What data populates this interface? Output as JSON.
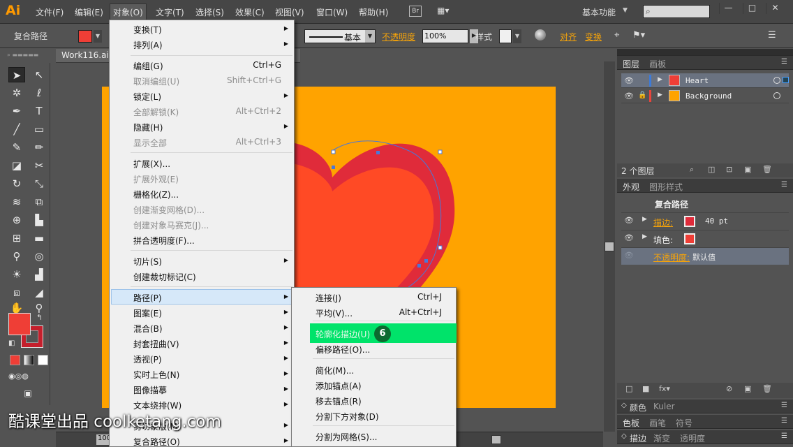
{
  "app": {
    "logo": "Ai"
  },
  "menubar": {
    "items": [
      "文件(F)",
      "编辑(E)",
      "对象(O)",
      "文字(T)",
      "选择(S)",
      "效果(C)",
      "视图(V)",
      "窗口(W)",
      "帮助(H)"
    ],
    "bridge": "Br",
    "workspace": "基本功能",
    "window_buttons": [
      "—",
      "□",
      "✕"
    ]
  },
  "control": {
    "selection_label": "复合路径",
    "fill_color": "#ef3e36",
    "stroke_style": "基本",
    "opacity_label": "不透明度",
    "opacity_value": "100%",
    "style_label": "样式",
    "align": "对齐",
    "transform": "变换"
  },
  "document": {
    "tab_label": "Work116.ai",
    "zoom": "100"
  },
  "object_menu": {
    "items": [
      {
        "label": "变换(T)",
        "shortcut": "",
        "submenu": true,
        "disabled": false
      },
      {
        "label": "排列(A)",
        "shortcut": "",
        "submenu": true,
        "disabled": false
      },
      {
        "label": "编组(G)",
        "shortcut": "Ctrl+G",
        "submenu": false,
        "disabled": false
      },
      {
        "label": "取消编组(U)",
        "shortcut": "Shift+Ctrl+G",
        "submenu": false,
        "disabled": true
      },
      {
        "label": "锁定(L)",
        "shortcut": "",
        "submenu": true,
        "disabled": false
      },
      {
        "label": "全部解锁(K)",
        "shortcut": "Alt+Ctrl+2",
        "submenu": false,
        "disabled": true
      },
      {
        "label": "隐藏(H)",
        "shortcut": "",
        "submenu": true,
        "disabled": false
      },
      {
        "label": "显示全部",
        "shortcut": "Alt+Ctrl+3",
        "submenu": false,
        "disabled": true
      },
      {
        "label": "扩展(X)...",
        "shortcut": "",
        "submenu": false,
        "disabled": false
      },
      {
        "label": "扩展外观(E)",
        "shortcut": "",
        "submenu": false,
        "disabled": true
      },
      {
        "label": "栅格化(Z)...",
        "shortcut": "",
        "submenu": false,
        "disabled": false
      },
      {
        "label": "创建渐变网格(D)...",
        "shortcut": "",
        "submenu": false,
        "disabled": true
      },
      {
        "label": "创建对象马赛克(J)...",
        "shortcut": "",
        "submenu": false,
        "disabled": true
      },
      {
        "label": "拼合透明度(F)...",
        "shortcut": "",
        "submenu": false,
        "disabled": false
      },
      {
        "label": "切片(S)",
        "shortcut": "",
        "submenu": true,
        "disabled": false
      },
      {
        "label": "创建裁切标记(C)",
        "shortcut": "",
        "submenu": false,
        "disabled": false
      },
      {
        "label": "路径(P)",
        "shortcut": "",
        "submenu": true,
        "disabled": false
      },
      {
        "label": "图案(E)",
        "shortcut": "",
        "submenu": true,
        "disabled": false
      },
      {
        "label": "混合(B)",
        "shortcut": "",
        "submenu": true,
        "disabled": false
      },
      {
        "label": "封套扭曲(V)",
        "shortcut": "",
        "submenu": true,
        "disabled": false
      },
      {
        "label": "透视(P)",
        "shortcut": "",
        "submenu": true,
        "disabled": false
      },
      {
        "label": "实时上色(N)",
        "shortcut": "",
        "submenu": true,
        "disabled": false
      },
      {
        "label": "图像描摹",
        "shortcut": "",
        "submenu": true,
        "disabled": false
      },
      {
        "label": "文本绕排(W)",
        "shortcut": "",
        "submenu": true,
        "disabled": false
      },
      {
        "label": "剪切蒙版(M)",
        "shortcut": "",
        "submenu": true,
        "disabled": false
      },
      {
        "label": "复合路径(O)",
        "shortcut": "",
        "submenu": true,
        "disabled": false
      }
    ]
  },
  "path_submenu": {
    "items": [
      {
        "label": "连接(J)",
        "shortcut": "Ctrl+J"
      },
      {
        "label": "平均(V)...",
        "shortcut": "Alt+Ctrl+J"
      },
      {
        "label": "轮廓化描边(U)",
        "shortcut": ""
      },
      {
        "label": "偏移路径(O)...",
        "shortcut": ""
      },
      {
        "label": "简化(M)...",
        "shortcut": ""
      },
      {
        "label": "添加锚点(A)",
        "shortcut": ""
      },
      {
        "label": "移去锚点(R)",
        "shortcut": ""
      },
      {
        "label": "分割下方对象(D)",
        "shortcut": ""
      },
      {
        "label": "分割为网格(S)...",
        "shortcut": ""
      }
    ],
    "step_badge": "6",
    "highlight_color": "#00e36a"
  },
  "layers_panel": {
    "tabs": [
      "图层",
      "画板"
    ],
    "layers": [
      {
        "name": "Heart",
        "color": "#3d7bd8"
      },
      {
        "name": "Background",
        "color": "#e8453c"
      }
    ],
    "count": "2 个图层"
  },
  "appearance_panel": {
    "tabs": [
      "外观",
      "图形样式"
    ],
    "title": "复合路径",
    "stroke_label": "描边:",
    "stroke_value": "40 pt",
    "fill_label": "填色:",
    "opacity_label": "不透明度:",
    "opacity_value": "默认值"
  },
  "collapsed_panels": {
    "row1": [
      "颜色",
      "Kuler"
    ],
    "row2": [
      "色板",
      "画笔",
      "符号"
    ],
    "row3": [
      "描边",
      "渐变",
      "透明度"
    ]
  },
  "watermark": "酷课堂出品 coolketang.com",
  "colors": {
    "artboard": "#ffa300",
    "heart_stroke": "#e02b3a",
    "heart_fill": "#ff4a25"
  }
}
